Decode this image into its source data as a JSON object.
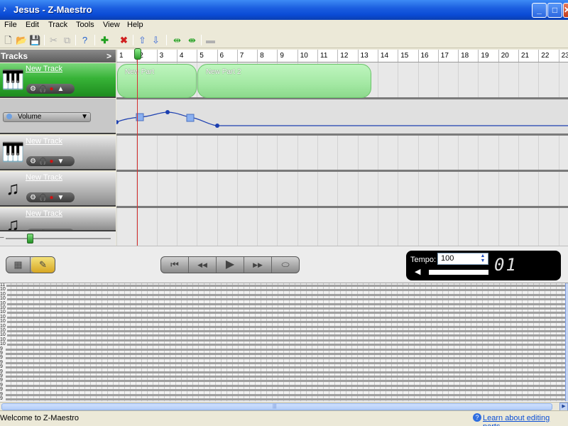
{
  "window": {
    "title": "Jesus - Z-Maestro",
    "minimize": "_",
    "maximize": "□",
    "close": "✕"
  },
  "menu": [
    "File",
    "Edit",
    "Track",
    "Tools",
    "View",
    "Help"
  ],
  "toolbar": {
    "icons": [
      "new-file-icon",
      "open-folder-icon",
      "save-icon",
      "cut-icon",
      "copy-icon",
      "help-icon",
      "add-icon",
      "delete-icon",
      "move-up-icon",
      "move-down-icon",
      "split-icon",
      "join-icon",
      "disabled-tool-icon"
    ]
  },
  "tracks_panel": {
    "header": "Tracks",
    "collapse_glyph": ">",
    "tracks": [
      {
        "name": "New Track",
        "instrument": "keyboard-icon",
        "selected": true,
        "last_control": "▲"
      },
      {
        "name": "New Track",
        "instrument": "keyboard-icon",
        "selected": false,
        "last_control": "▼"
      },
      {
        "name": "New Track",
        "instrument": "music-notes-icon",
        "selected": false,
        "last_control": "▼"
      },
      {
        "name": "New Track",
        "instrument": "music-notes-icon",
        "selected": false,
        "last_control": "▼"
      }
    ],
    "automation": {
      "param": "Volume",
      "chevron": "▼"
    }
  },
  "timeline": {
    "ruler": [
      "1",
      "2",
      "3",
      "4",
      "5",
      "6",
      "7",
      "8",
      "9",
      "10",
      "11",
      "12",
      "13",
      "14",
      "15",
      "16",
      "17",
      "18",
      "19",
      "20",
      "21",
      "22",
      "23"
    ],
    "parts": [
      "New Part",
      "New Part 2"
    ]
  },
  "transport": {
    "buttons": {
      "rewind_start": "⏮",
      "rewind": "◀◀",
      "play": "▶",
      "forward": "▶▶",
      "record_loop": "⬭"
    },
    "tempo_label": "Tempo:",
    "tempo_value": "100",
    "counter": "01"
  },
  "piano_roll": {
    "key_labels": [
      "11",
      "10",
      "10",
      "10",
      "10",
      "10",
      "10",
      "10",
      "10",
      "10",
      "10",
      "10",
      "10",
      "10",
      "9",
      "9",
      "9",
      "9",
      "9",
      "9",
      "9",
      "9",
      "9",
      "9",
      "9",
      "9"
    ]
  },
  "status": {
    "text": "Welcome to Z-Maestro",
    "help_link": "Learn about editing parts..."
  },
  "colors": {
    "accent_green": "#37b337",
    "titlebar_blue": "#0a4bd6",
    "playhead_red": "#d43030",
    "automation_blue": "#1c3fb0"
  }
}
